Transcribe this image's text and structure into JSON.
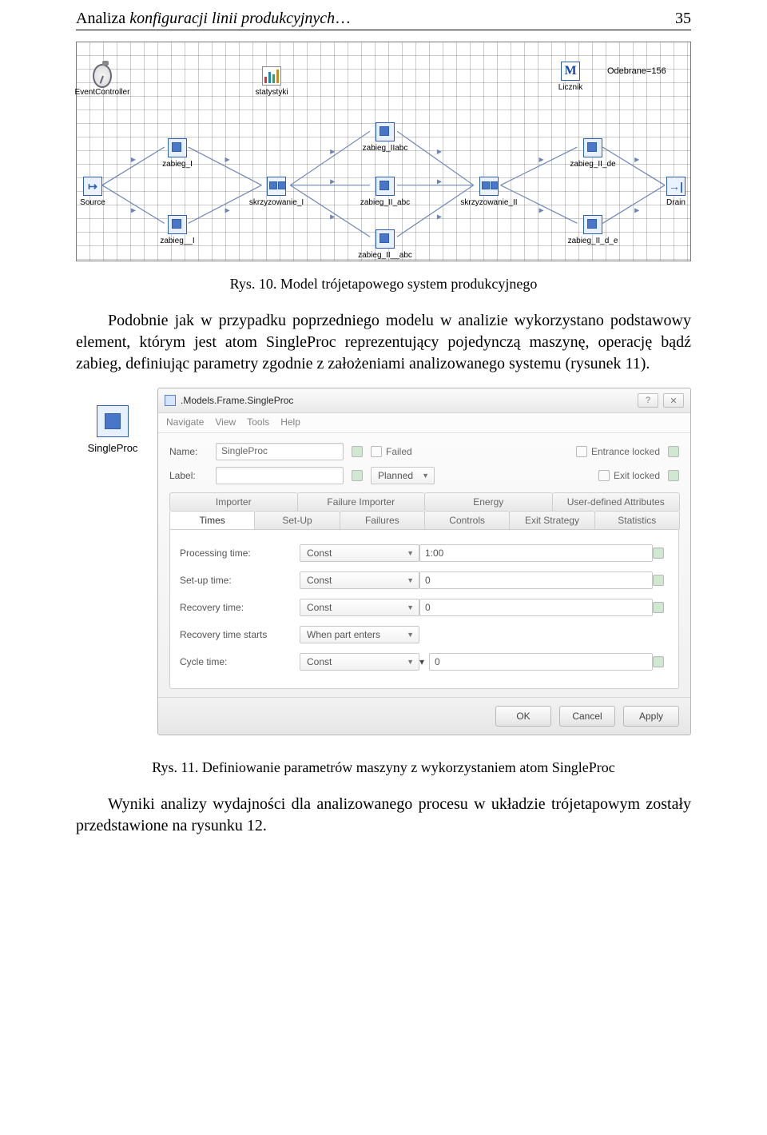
{
  "header": {
    "title_plain": "Analiza",
    "title_italic": " konfiguracji linii produkcyjnych",
    "title_dots": "…",
    "page_no": "35"
  },
  "fig10": {
    "odebrane_label": "Odebrane=156",
    "nodes": {
      "event": "EventController",
      "stats": "statystyki",
      "licznik": "Licznik",
      "source": "Source",
      "drain": "Drain",
      "zabieg_I": "zabieg_I",
      "zabieg__I": "zabieg__I",
      "skrzy_I": "skrzyzowanie_I",
      "zabieg_IIabc": "zabieg_IIabc",
      "zabieg_II_abc": "zabieg_II_abc",
      "zabieg_II__abc": "zabieg_II__abc",
      "skrzy_II": "skrzyzowanie_II",
      "zabieg_II_de": "zabieg_II_de",
      "zabieg_II_d_e": "zabieg_II_d_e"
    },
    "caption": "Rys. 10. Model trójetapowego system produkcyjnego"
  },
  "para1": "Podobnie jak w przypadku poprzedniego modelu w analizie wykorzystano podstawowy element, którym jest atom SingleProc reprezentujący pojedynczą maszynę, operację bądź zabieg, definiując parametry zgodnie z założeniami analizowanego systemu (rysunek 11).",
  "fig11": {
    "left_label": "SingleProc",
    "title": ".Models.Frame.SingleProc",
    "menu": [
      "Navigate",
      "View",
      "Tools",
      "Help"
    ],
    "name_label": "Name:",
    "name_value": "SingleProc",
    "label_label": "Label:",
    "failed": "Failed",
    "planned": "Planned",
    "entrance": "Entrance locked",
    "exit": "Exit locked",
    "tabs_top": [
      "Importer",
      "Failure Importer",
      "Energy",
      "User-defined Attributes"
    ],
    "tabs_bottom": [
      "Times",
      "Set-Up",
      "Failures",
      "Controls",
      "Exit Strategy",
      "Statistics"
    ],
    "rows": {
      "processing": {
        "label": "Processing time:",
        "mode": "Const",
        "value": "1:00"
      },
      "setup": {
        "label": "Set-up time:",
        "mode": "Const",
        "value": "0"
      },
      "recovery": {
        "label": "Recovery time:",
        "mode": "Const",
        "value": "0"
      },
      "recstart": {
        "label": "Recovery time starts",
        "mode": "When part enters",
        "value": ""
      },
      "cycle": {
        "label": "Cycle time:",
        "mode": "Const",
        "value": "0"
      }
    },
    "buttons": {
      "ok": "OK",
      "cancel": "Cancel",
      "apply": "Apply"
    },
    "help": "?",
    "close": "✕",
    "caption": "Rys. 11. Definiowanie parametrów maszyny z wykorzystaniem atom SingleProc"
  },
  "para2": "Wyniki analizy wydajności dla analizowanego procesu w układzie trójetapowym zostały przedstawione na rysunku 12."
}
